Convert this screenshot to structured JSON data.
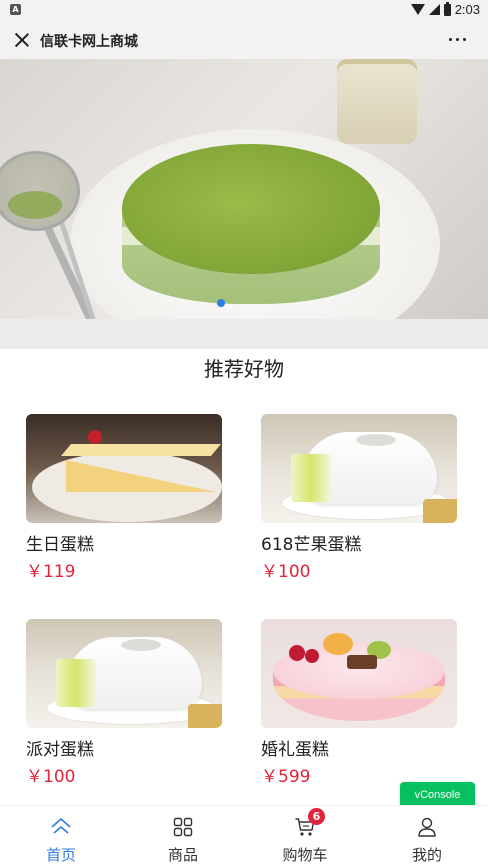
{
  "status_bar": {
    "time": "2:03"
  },
  "nav": {
    "title": "信联卡网上商城"
  },
  "banner": {
    "slide_count": 1,
    "active_slide": 1
  },
  "section": {
    "title": "推荐好物"
  },
  "products": [
    {
      "name": "生日蛋糕",
      "price": "￥119",
      "image": "cheesecake-slice"
    },
    {
      "name": "618芒果蛋糕",
      "price": "￥100",
      "image": "white-mango-cake"
    },
    {
      "name": "派对蛋糕",
      "price": "￥100",
      "image": "white-mango-cake"
    },
    {
      "name": "婚礼蛋糕",
      "price": "￥599",
      "image": "heart-fruit-cake"
    }
  ],
  "vconsole": {
    "label": "vConsole"
  },
  "tabbar": {
    "tabs": [
      {
        "label": "首页",
        "icon": "home-icon",
        "active": true
      },
      {
        "label": "商品",
        "icon": "grid-icon",
        "active": false
      },
      {
        "label": "购物车",
        "icon": "cart-icon",
        "active": false
      },
      {
        "label": "我的",
        "icon": "user-icon",
        "active": false
      }
    ],
    "cart_badge": "6"
  },
  "colors": {
    "accent": "#2f7de1",
    "price": "#e0233b",
    "vconsole": "#07c160"
  }
}
